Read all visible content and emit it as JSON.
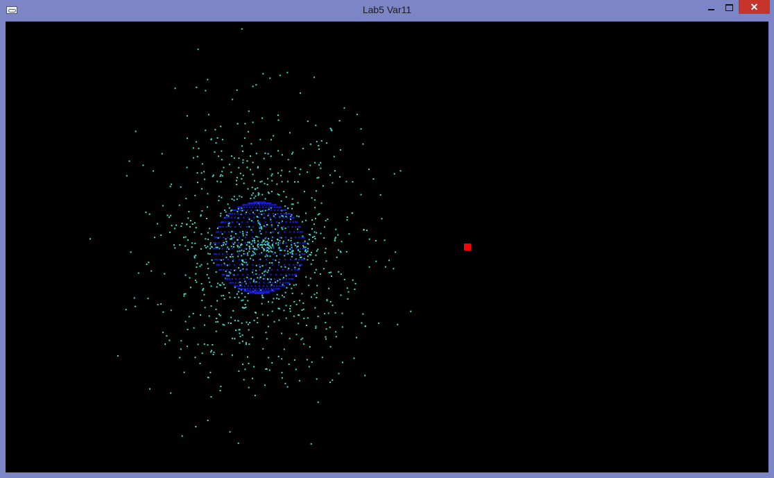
{
  "window": {
    "title": "Lab5 Var11",
    "close_glyph": "✕"
  },
  "colors": {
    "frame": "#7c86c6",
    "canvas_bg": "#000000",
    "scatter_particles": "#40e0d0",
    "sphere_particles": "#1a1aff",
    "marker": "#ff0000"
  },
  "icons": {
    "app": "app-icon",
    "minimize": "minimize-icon",
    "maximize": "maximize-icon",
    "close": "close-icon"
  }
}
